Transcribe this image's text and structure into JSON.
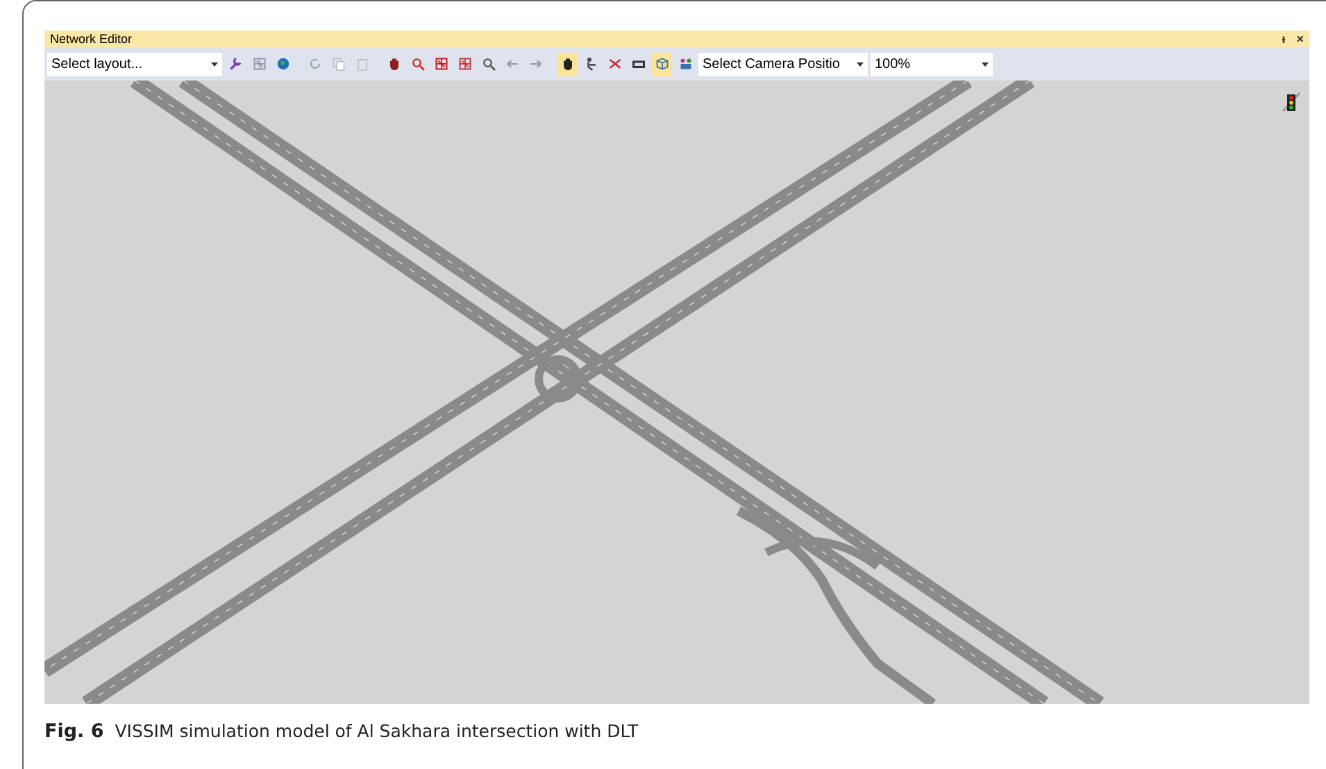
{
  "window": {
    "title": "Network Editor",
    "pin": "ᵼ",
    "close": "×"
  },
  "toolbar": {
    "layout_select": "Select layout...",
    "camera_select": "Select Camera Positio",
    "zoom_select": "100%",
    "tools": [
      {
        "selected": false
      },
      {
        "selected": false
      },
      {
        "selected": false
      },
      {
        "selected": false
      },
      {
        "selected": false
      },
      {
        "selected": false
      },
      {
        "selected": false
      },
      {
        "selected": false
      },
      {
        "selected": false
      },
      {
        "selected": false
      },
      {
        "selected": false
      },
      {
        "selected": false
      },
      {
        "selected": false
      },
      {
        "selected": true
      },
      {
        "selected": false
      },
      {
        "selected": false
      },
      {
        "selected": false
      },
      {
        "selected": true
      },
      {
        "selected": false
      }
    ]
  },
  "caption": {
    "label": "Fig. 6",
    "text": "VISSIM simulation model of Al Sakhara intersection with DLT"
  }
}
